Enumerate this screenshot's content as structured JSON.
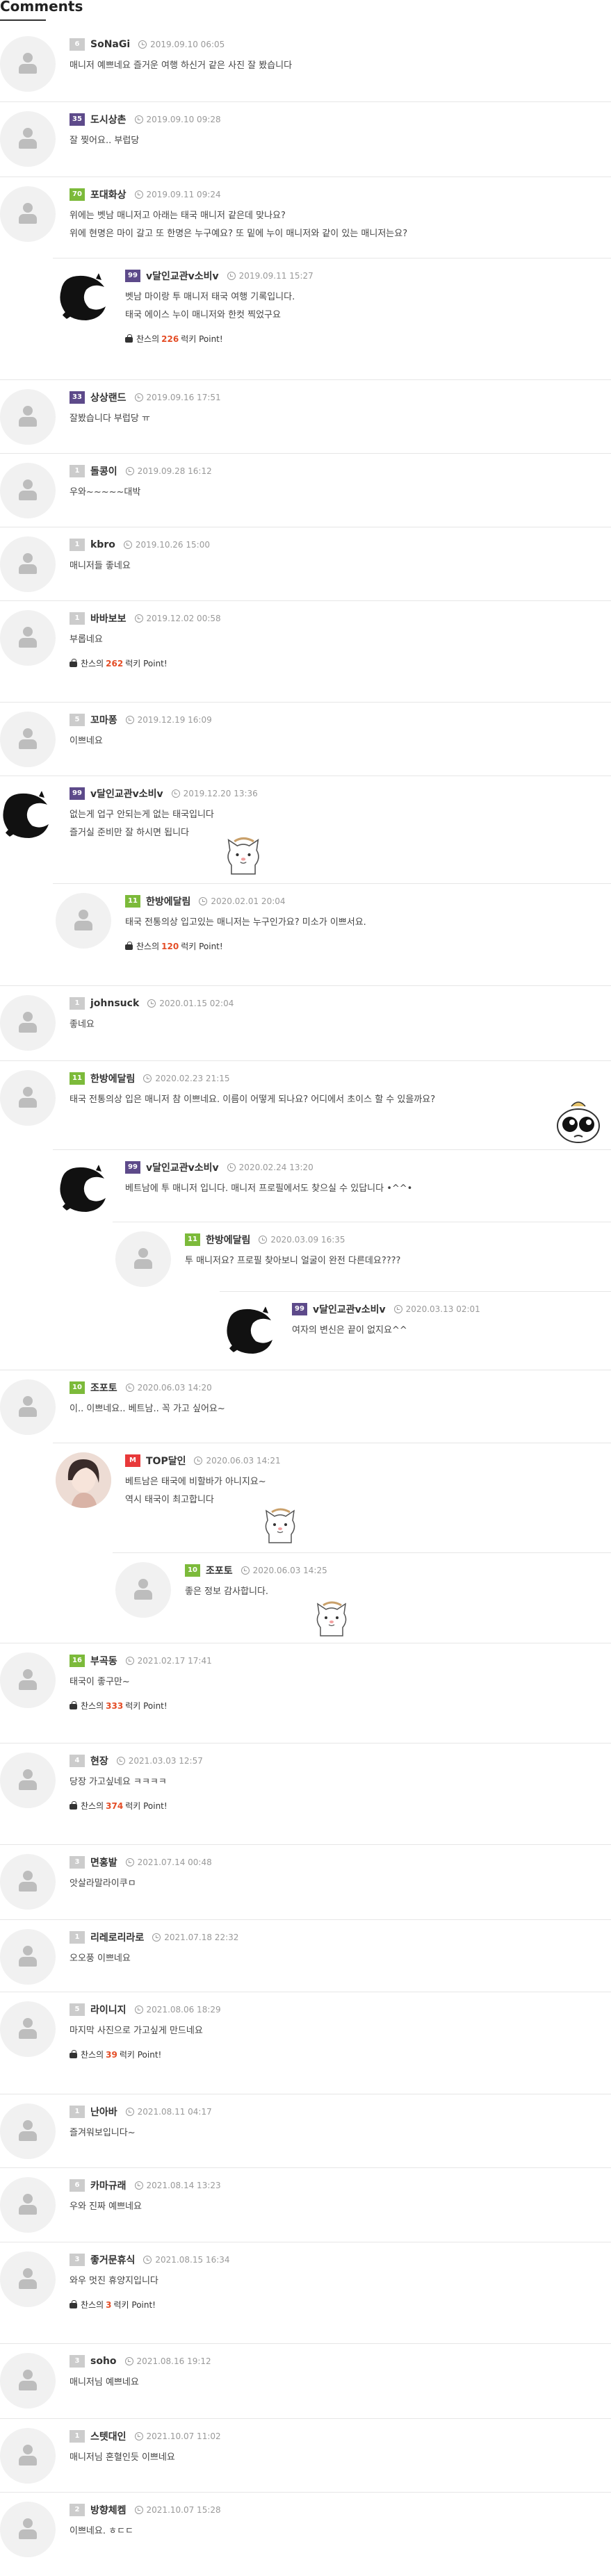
{
  "section_title": "Comments",
  "point_prefix": "찬스의",
  "point_suffix": "럭키 Point!",
  "level_colors": {
    "gray": "#cccccc",
    "purple": "#5d4a8a",
    "green": "#7cba3a",
    "red": "#e8393a"
  },
  "comments": [
    {
      "level": "6",
      "nick": "SoNaGi",
      "date": "2019.09.10 06:05",
      "lines": [
        "매니저 예쁘네요 즐거운 여행 하신거 같은 사진 잘 봤습니다"
      ]
    },
    {
      "level": "35",
      "nick": "도시상촌",
      "date": "2019.09.10 09:28",
      "lines": [
        "잘 찢어요.. 부럽당"
      ]
    },
    {
      "level": "70",
      "nick": "포대화상",
      "date": "2019.09.11 09:24",
      "lines": [
        "위에는 벳남 매니저고 아래는 태국 매니저 같은데 맞나요?",
        "위에 현명은 마이 갈고 또 한명은 누구예요? 또 밑에 누이 매니저와 같이 있는 매니저는요?"
      ]
    },
    {
      "level": "99",
      "nick": "v달인교관v소비v",
      "date": "2019.09.11 15:27",
      "lines": [
        "벳남 마이랑 투 매니저 태국 여행 기록입니다.",
        "태국 에이스 누이 매니저와 한컷 찍었구요"
      ],
      "point": "226"
    },
    {
      "level": "33",
      "nick": "상상랜드",
      "date": "2019.09.16 17:51",
      "lines": [
        "잘봤습니다 부럽당 ㅠ"
      ]
    },
    {
      "level": "1",
      "nick": "돌콩이",
      "date": "2019.09.28 16:12",
      "lines": [
        "우와~~~~~대박"
      ]
    },
    {
      "level": "1",
      "nick": "kbro",
      "date": "2019.10.26 15:00",
      "lines": [
        "매니저들 좋네요"
      ]
    },
    {
      "level": "1",
      "nick": "바바보보",
      "date": "2019.12.02 00:58",
      "lines": [
        "부롭네요"
      ],
      "point": "262"
    },
    {
      "level": "5",
      "nick": "꼬마퐁",
      "date": "2019.12.19 16:09",
      "lines": [
        "이쁘네요"
      ]
    },
    {
      "level": "99",
      "nick": "v달인교관v소비v",
      "date": "2019.12.20 13:36",
      "lines": [
        "없는게 업구 안되는게 없는 태국입니다",
        "즐거실 준비만 잘 하시면 됩니다"
      ]
    },
    {
      "level": "11",
      "nick": "한방에달림",
      "date": "2020.02.01 20:04",
      "lines": [
        "태국 전통의상 입고있는 매니저는 누구인가요? 미소가 이쁘서요."
      ],
      "point": "120"
    },
    {
      "level": "1",
      "nick": "johnsuck",
      "date": "2020.01.15 02:04",
      "lines": [
        "좋네요"
      ]
    },
    {
      "level": "11",
      "nick": "한방에달림",
      "date": "2020.02.23 21:15",
      "lines": [
        "태국 전통의상 입은 매니저 참 이쁘네요. 이름이 어떻게 되나요? 어디에서 초이스 할 수 있을까요?"
      ]
    },
    {
      "level": "99",
      "nick": "v달인교관v소비v",
      "date": "2020.02.24 13:20",
      "lines": [
        "베트남에 투 매니저 입니다. 매니저 프로필에서도 찾으실 수 있답니다 •^^•"
      ]
    },
    {
      "level": "11",
      "nick": "한방에달림",
      "date": "2020.03.09 16:35",
      "lines": [
        "투 매니저요? 프로필 찾아보니 얼굴이 완전 다른데요????"
      ]
    },
    {
      "level": "99",
      "nick": "v달인교관v소비v",
      "date": "2020.03.13 02:01",
      "lines": [
        "여자의 변신은 끝이 없지요^^"
      ]
    },
    {
      "level": "10",
      "nick": "조포토",
      "date": "2020.06.03 14:20",
      "lines": [
        "이.. 이쁘네요.. 베트남.. 꼭 가고 싶어요~"
      ]
    },
    {
      "level": "M",
      "nick": "TOP달인",
      "date": "2020.06.03 14:21",
      "lines": [
        "베트남은 태국에 비할바가 아니지요~",
        "역시 태국이 최고합니다"
      ]
    },
    {
      "level": "10",
      "nick": "조포토",
      "date": "2020.06.03 14:25",
      "lines": [
        "좋은 정보 감사합니다."
      ]
    },
    {
      "level": "16",
      "nick": "부곡동",
      "date": "2021.02.17 17:41",
      "lines": [
        "태국이 좋구만~"
      ],
      "point": "333"
    },
    {
      "level": "4",
      "nick": "현장",
      "date": "2021.03.03 12:57",
      "lines": [
        "당장 가고싶네요 ㅋㅋㅋㅋ"
      ],
      "point": "374"
    },
    {
      "level": "3",
      "nick": "면홍발",
      "date": "2021.07.14 00:48",
      "lines": [
        "앗살라말라이쿠ㅁ"
      ]
    },
    {
      "level": "1",
      "nick": "리레로리라로",
      "date": "2021.07.18 22:32",
      "lines": [
        "오오풍 이쁘네요"
      ]
    },
    {
      "level": "5",
      "nick": "라이니지",
      "date": "2021.08.06 18:29",
      "lines": [
        "마지막 사진으로 가고싶게 만드네요"
      ],
      "point": "39"
    },
    {
      "level": "1",
      "nick": "난아바",
      "date": "2021.08.11 04:17",
      "lines": [
        "즐겨워보입니다~"
      ]
    },
    {
      "level": "6",
      "nick": "카마규래",
      "date": "2021.08.14 13:23",
      "lines": [
        "우와 진짜 예쁘네요"
      ]
    },
    {
      "level": "3",
      "nick": "좋거문휴식",
      "date": "2021.08.15 16:34",
      "lines": [
        "와우 멋진 휴양지입니다"
      ],
      "point": "3"
    },
    {
      "level": "3",
      "nick": "soho",
      "date": "2021.08.16 19:12",
      "lines": [
        "매니저님 예쁘네요"
      ]
    },
    {
      "level": "1",
      "nick": "스텟대인",
      "date": "2021.10.07 11:02",
      "lines": [
        "매니저님 혼혈인듯 이쁘네요"
      ]
    },
    {
      "level": "2",
      "nick": "방향체켐",
      "date": "2021.10.07 15:28",
      "lines": [
        "이쁘네요. ㅎㄷㄷ"
      ]
    }
  ]
}
